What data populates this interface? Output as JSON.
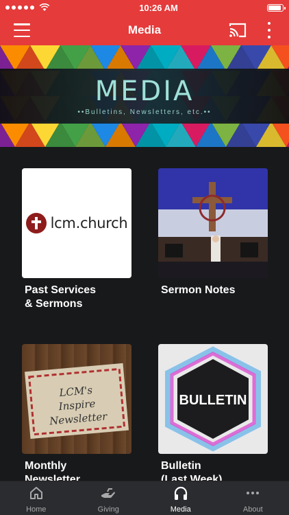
{
  "status_bar": {
    "time": "10:26 AM",
    "battery_level": 0.95
  },
  "header": {
    "title": "Media"
  },
  "banner": {
    "title": "MEDIA",
    "subtitle": "••Bulletins, Newsletters, etc.••"
  },
  "thumbnails": {
    "lcm_text": "lcm.church",
    "bulletin_text": "BULLETIN",
    "newsletter_lines": [
      "LCM's",
      "Inspire",
      "Newsletter"
    ]
  },
  "tiles": [
    {
      "label": "Past Services\n& Sermons"
    },
    {
      "label": "Sermon Notes"
    },
    {
      "label": "Monthly\nNewsletter"
    },
    {
      "label": "Bulletin\n(Last Week)"
    }
  ],
  "tabs": [
    {
      "label": "Home",
      "icon": "home-icon"
    },
    {
      "label": "Giving",
      "icon": "giving-icon"
    },
    {
      "label": "Media",
      "icon": "headphones-icon"
    },
    {
      "label": "About",
      "icon": "more-dots-icon"
    }
  ],
  "colors": {
    "accent": "#e53b3b",
    "background": "#18191b",
    "tabbar": "#2b2c2f"
  }
}
